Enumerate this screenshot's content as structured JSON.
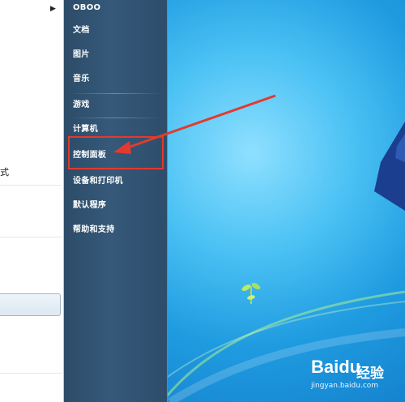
{
  "start_menu": {
    "left_partial_text": "式",
    "right_items": [
      {
        "label": "OBOO"
      },
      {
        "label": "文档"
      },
      {
        "label": "图片"
      },
      {
        "label": "音乐"
      },
      {
        "label": "游戏"
      },
      {
        "label": "计算机"
      },
      {
        "label": "控制面板"
      },
      {
        "label": "设备和打印机"
      },
      {
        "label": "默认程序"
      },
      {
        "label": "帮助和支持"
      }
    ],
    "highlighted_item": "控制面板"
  },
  "watermark": {
    "brand": "Baidu",
    "suffix": "经验",
    "url": "jingyan.baidu.com"
  },
  "colors": {
    "highlight": "#e23a2e",
    "panel": "#36597a"
  }
}
